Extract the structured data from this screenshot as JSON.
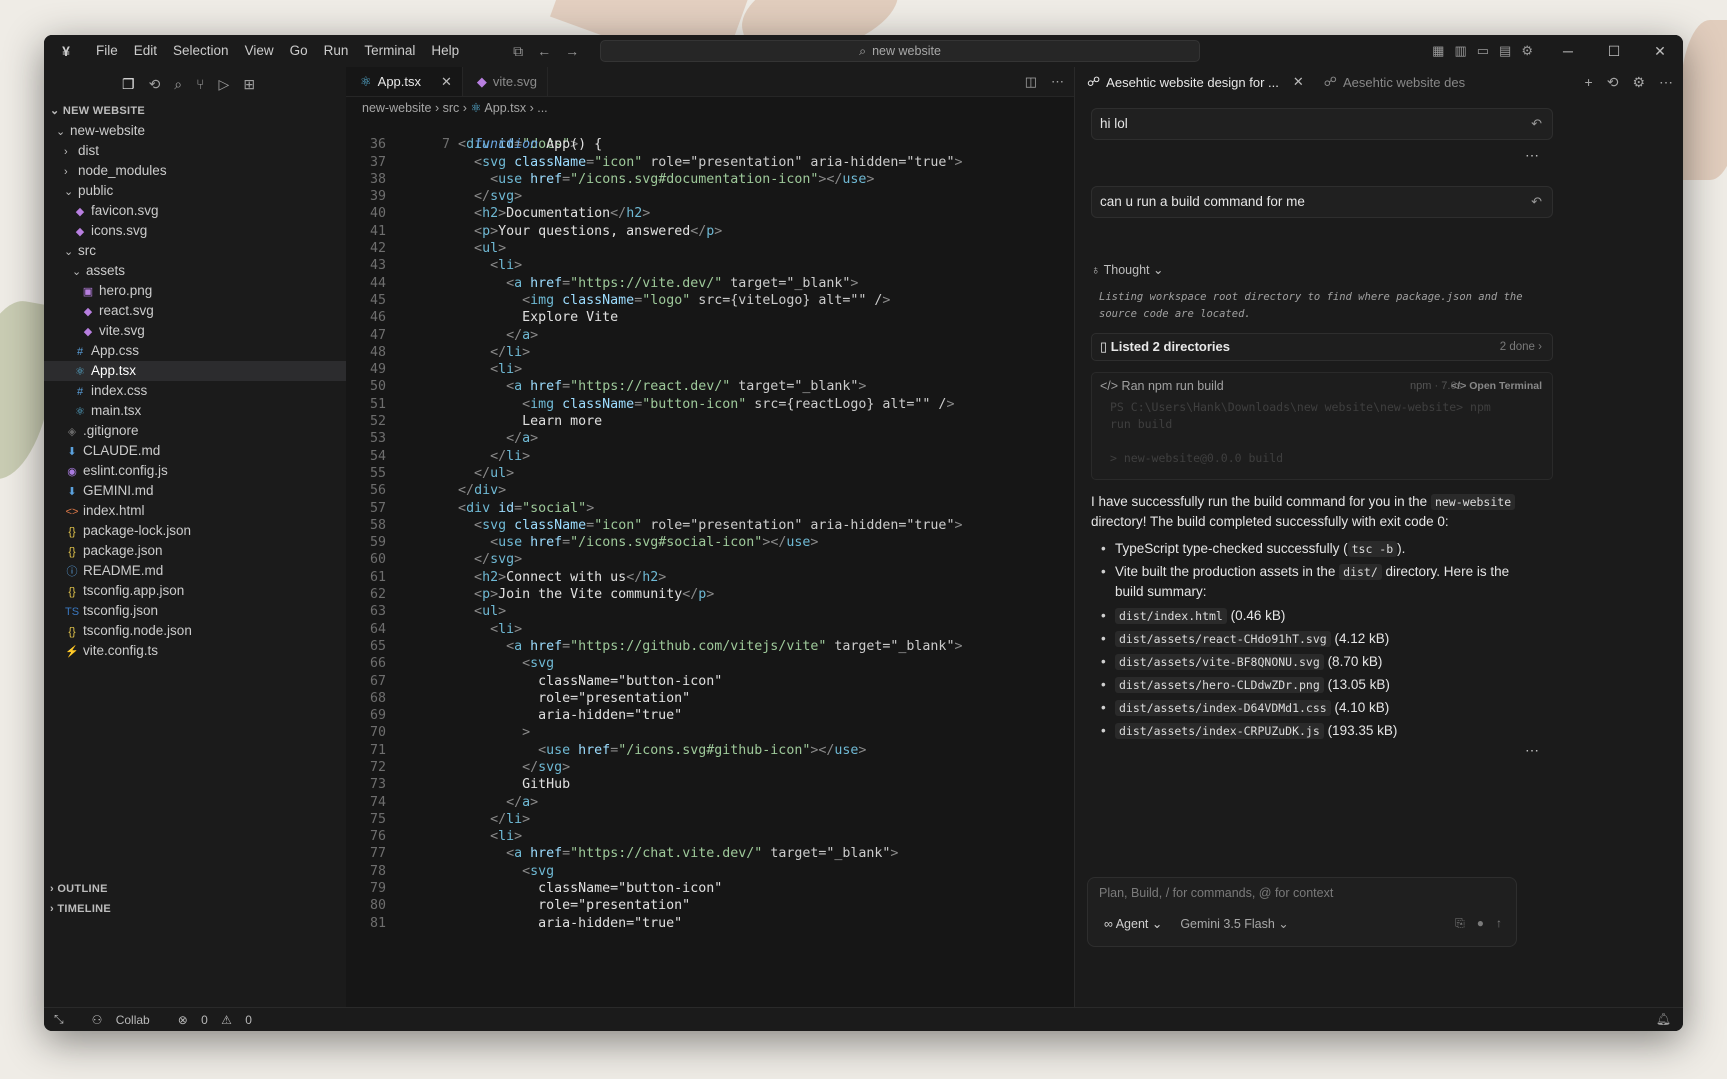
{
  "titlebar": {
    "menu": [
      "File",
      "Edit",
      "Selection",
      "View",
      "Go",
      "Run",
      "Terminal",
      "Help"
    ],
    "search": "new website"
  },
  "sidebar": {
    "section": "NEW WEBSITE",
    "tree": [
      {
        "label": "new-website",
        "depth": 0,
        "kind": "folder-open",
        "icon_color": "#cccccc"
      },
      {
        "label": "dist",
        "depth": 1,
        "kind": "folder",
        "icon_color": "#cccccc"
      },
      {
        "label": "node_modules",
        "depth": 1,
        "kind": "folder",
        "icon_color": "#cccccc"
      },
      {
        "label": "public",
        "depth": 1,
        "kind": "folder-open",
        "icon_color": "#cccccc"
      },
      {
        "label": "favicon.svg",
        "depth": 2,
        "kind": "svg",
        "icon_color": "#b87fe0"
      },
      {
        "label": "icons.svg",
        "depth": 2,
        "kind": "svg",
        "icon_color": "#b87fe0"
      },
      {
        "label": "src",
        "depth": 1,
        "kind": "folder-open",
        "icon_color": "#cccccc"
      },
      {
        "label": "assets",
        "depth": 2,
        "kind": "folder-open",
        "icon_color": "#cccccc"
      },
      {
        "label": "hero.png",
        "depth": 3,
        "kind": "image",
        "icon_color": "#b87fe0"
      },
      {
        "label": "react.svg",
        "depth": 3,
        "kind": "svg",
        "icon_color": "#b87fe0"
      },
      {
        "label": "vite.svg",
        "depth": 3,
        "kind": "svg",
        "icon_color": "#b87fe0"
      },
      {
        "label": "App.css",
        "depth": 2,
        "kind": "css",
        "icon_color": "#5aa0dc"
      },
      {
        "label": "App.tsx",
        "depth": 2,
        "kind": "react",
        "icon_color": "#5ab8e0",
        "selected": true
      },
      {
        "label": "index.css",
        "depth": 2,
        "kind": "css",
        "icon_color": "#5aa0dc"
      },
      {
        "label": "main.tsx",
        "depth": 2,
        "kind": "react",
        "icon_color": "#5ab8e0"
      },
      {
        "label": ".gitignore",
        "depth": 1,
        "kind": "git",
        "icon_color": "#6a6a6a"
      },
      {
        "label": "CLAUDE.md",
        "depth": 1,
        "kind": "md",
        "icon_color": "#5aa0dc"
      },
      {
        "label": "eslint.config.js",
        "depth": 1,
        "kind": "eslint",
        "icon_color": "#a97be0"
      },
      {
        "label": "GEMINI.md",
        "depth": 1,
        "kind": "md",
        "icon_color": "#5aa0dc"
      },
      {
        "label": "index.html",
        "depth": 1,
        "kind": "html",
        "icon_color": "#e07a4a"
      },
      {
        "label": "package-lock.json",
        "depth": 1,
        "kind": "json",
        "icon_color": "#e0c24a"
      },
      {
        "label": "package.json",
        "depth": 1,
        "kind": "json",
        "icon_color": "#e0c24a"
      },
      {
        "label": "README.md",
        "depth": 1,
        "kind": "info",
        "icon_color": "#5aa0dc"
      },
      {
        "label": "tsconfig.app.json",
        "depth": 1,
        "kind": "json",
        "icon_color": "#e0c24a"
      },
      {
        "label": "tsconfig.json",
        "depth": 1,
        "kind": "ts",
        "icon_color": "#3a78c0"
      },
      {
        "label": "tsconfig.node.json",
        "depth": 1,
        "kind": "json",
        "icon_color": "#e0c24a"
      },
      {
        "label": "vite.config.ts",
        "depth": 1,
        "kind": "vite",
        "icon_color": "#e0c24a"
      }
    ],
    "outline": "OUTLINE",
    "timeline": "TIMELINE"
  },
  "editor": {
    "tabs": [
      {
        "label": "App.tsx",
        "active": true
      },
      {
        "label": "vite.svg",
        "active": false
      }
    ],
    "breadcrumb": [
      "new-website",
      "src",
      "App.tsx",
      "..."
    ],
    "sticky": {
      "ln": "7",
      "text": "function App() {"
    },
    "lines": [
      {
        "ln": "36",
        "code": "      <div id=\"docs\">"
      },
      {
        "ln": "37",
        "code": "        <svg className=\"icon\" role=\"presentation\" aria-hidden=\"true\">"
      },
      {
        "ln": "38",
        "code": "          <use href=\"/icons.svg#documentation-icon\"></use>"
      },
      {
        "ln": "39",
        "code": "        </svg>"
      },
      {
        "ln": "40",
        "code": "        <h2>Documentation</h2>"
      },
      {
        "ln": "41",
        "code": "        <p>Your questions, answered</p>"
      },
      {
        "ln": "42",
        "code": "        <ul>"
      },
      {
        "ln": "43",
        "code": "          <li>"
      },
      {
        "ln": "44",
        "code": "            <a href=\"https://vite.dev/\" target=\"_blank\">"
      },
      {
        "ln": "45",
        "code": "              <img className=\"logo\" src={viteLogo} alt=\"\" />"
      },
      {
        "ln": "46",
        "code": "              Explore Vite"
      },
      {
        "ln": "47",
        "code": "            </a>"
      },
      {
        "ln": "48",
        "code": "          </li>"
      },
      {
        "ln": "49",
        "code": "          <li>"
      },
      {
        "ln": "50",
        "code": "            <a href=\"https://react.dev/\" target=\"_blank\">"
      },
      {
        "ln": "51",
        "code": "              <img className=\"button-icon\" src={reactLogo} alt=\"\" />"
      },
      {
        "ln": "52",
        "code": "              Learn more"
      },
      {
        "ln": "53",
        "code": "            </a>"
      },
      {
        "ln": "54",
        "code": "          </li>"
      },
      {
        "ln": "55",
        "code": "        </ul>"
      },
      {
        "ln": "56",
        "code": "      </div>"
      },
      {
        "ln": "57",
        "code": "      <div id=\"social\">"
      },
      {
        "ln": "58",
        "code": "        <svg className=\"icon\" role=\"presentation\" aria-hidden=\"true\">"
      },
      {
        "ln": "59",
        "code": "          <use href=\"/icons.svg#social-icon\"></use>"
      },
      {
        "ln": "60",
        "code": "        </svg>"
      },
      {
        "ln": "61",
        "code": "        <h2>Connect with us</h2>"
      },
      {
        "ln": "62",
        "code": "        <p>Join the Vite community</p>"
      },
      {
        "ln": "63",
        "code": "        <ul>"
      },
      {
        "ln": "64",
        "code": "          <li>"
      },
      {
        "ln": "65",
        "code": "            <a href=\"https://github.com/vitejs/vite\" target=\"_blank\">"
      },
      {
        "ln": "66",
        "code": "              <svg"
      },
      {
        "ln": "67",
        "code": "                className=\"button-icon\""
      },
      {
        "ln": "68",
        "code": "                role=\"presentation\""
      },
      {
        "ln": "69",
        "code": "                aria-hidden=\"true\""
      },
      {
        "ln": "70",
        "code": "              >"
      },
      {
        "ln": "71",
        "code": "                <use href=\"/icons.svg#github-icon\"></use>"
      },
      {
        "ln": "72",
        "code": "              </svg>"
      },
      {
        "ln": "73",
        "code": "              GitHub"
      },
      {
        "ln": "74",
        "code": "            </a>"
      },
      {
        "ln": "75",
        "code": "          </li>"
      },
      {
        "ln": "76",
        "code": "          <li>"
      },
      {
        "ln": "77",
        "code": "            <a href=\"https://chat.vite.dev/\" target=\"_blank\">"
      },
      {
        "ln": "78",
        "code": "              <svg"
      },
      {
        "ln": "79",
        "code": "                className=\"button-icon\""
      },
      {
        "ln": "80",
        "code": "                role=\"presentation\""
      },
      {
        "ln": "81",
        "code": "                aria-hidden=\"true\""
      }
    ]
  },
  "agent": {
    "tabs": [
      {
        "label": "Aesehtic website design for ...",
        "active": true
      },
      {
        "label": "Aesehtic website des",
        "active": false
      }
    ],
    "user_msg_1": "hi lol",
    "user_msg_2": "can u run a build command for me",
    "thought_label": "Thought",
    "thought_text": "Listing workspace root directory to find where package.json and the source code are located.",
    "listed_label": "Listed 2 directories",
    "listed_meta": "2 done",
    "run_label": "Ran npm run build",
    "run_meta": "npm · 7.6s",
    "run_open": "Open Terminal",
    "run_output": [
      "PS C:\\Users\\Hank\\Downloads\\new website\\new-website> npm",
      "run build",
      "",
      "> new-website@0.0.0 build"
    ],
    "answer_1": "I have successfully run the build command for you in the",
    "answer_code_1": "new-website",
    "answer_2": "directory! The build completed successfully with exit code 0:",
    "bullet_1_pre": "TypeScript type-checked successfully (",
    "bullet_1_code": "tsc -b",
    "bullet_1_post": ").",
    "bullet_2_pre": "Vite built the production assets in the",
    "bullet_2_code": "dist/",
    "bullet_2_post": "directory. Here is the build summary:",
    "files": [
      {
        "name": "dist/index.html",
        "size": "(0.46 kB)"
      },
      {
        "name": "dist/assets/react-CHdo91hT.svg",
        "size": "(4.12 kB)"
      },
      {
        "name": "dist/assets/vite-BF8QNONU.svg",
        "size": "(8.70 kB)"
      },
      {
        "name": "dist/assets/hero-CLDdwZDr.png",
        "size": "(13.05 kB)"
      },
      {
        "name": "dist/assets/index-D64VDMd1.css",
        "size": "(4.10 kB)"
      },
      {
        "name": "dist/assets/index-CRPUZuDK.js",
        "size": "(193.35 kB)"
      }
    ],
    "composer_placeholder": "Plan, Build, / for commands, @ for context",
    "mode": "Agent",
    "model": "Gemini 3.5 Flash"
  },
  "statusbar": {
    "collab": "Collab",
    "errors": "0",
    "warnings": "0"
  },
  "colors": {
    "accent_selected": "#2c2c2e",
    "editor_bg": "#161616"
  }
}
